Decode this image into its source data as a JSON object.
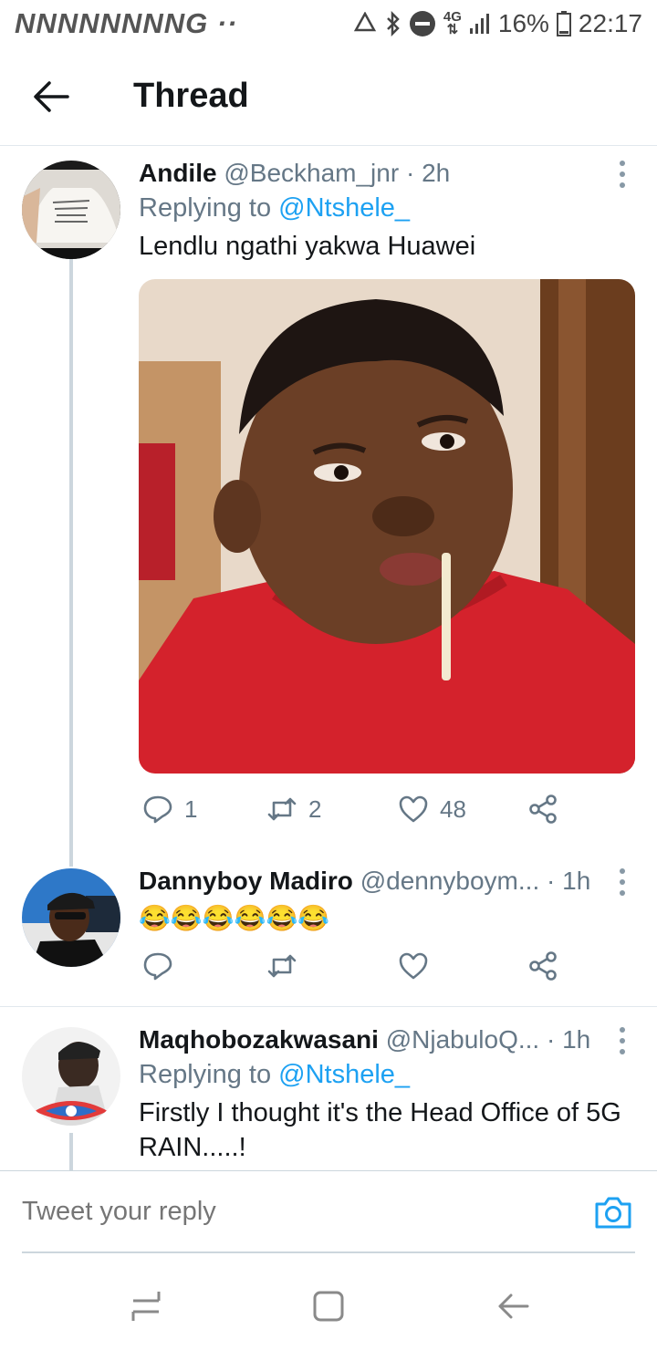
{
  "status_bar": {
    "left_icons_text": "NNNNNNNNG ··",
    "network_top": "4G",
    "battery": "16%",
    "time": "22:17"
  },
  "header": {
    "title": "Thread"
  },
  "tweets": [
    {
      "name": "Andile",
      "handle": "@Beckham_jnr",
      "time": "· 2h",
      "replying_label": "Replying to",
      "replying_handle": "@Ntshele_",
      "text": "Lendlu ngathi yakwa Huawei",
      "reply_count": "1",
      "retweet_count": "2",
      "like_count": "48"
    },
    {
      "name": "Dannyboy Madiro",
      "handle": "@dennyboym...",
      "time": "· 1h",
      "text": "😂😂😂😂😂😂"
    },
    {
      "name": "Maqhobozakwasani",
      "handle": "@NjabuloQ...",
      "time": "· 1h",
      "replying_label": "Replying to",
      "replying_handle": "@Ntshele_",
      "text": "Firstly I thought it's the Head Office of 5G RAIN.....!"
    }
  ],
  "compose": {
    "placeholder": "Tweet your reply"
  },
  "colors": {
    "link": "#1da1f2",
    "muted": "#657786",
    "divider": "#e1e8ed",
    "thread_line": "#ccd6dd"
  },
  "icons": [
    "back-arrow-icon",
    "more-vertical-icon",
    "reply-icon",
    "retweet-icon",
    "like-icon",
    "share-icon",
    "camera-icon",
    "recents-icon",
    "home-icon",
    "back-nav-icon"
  ]
}
